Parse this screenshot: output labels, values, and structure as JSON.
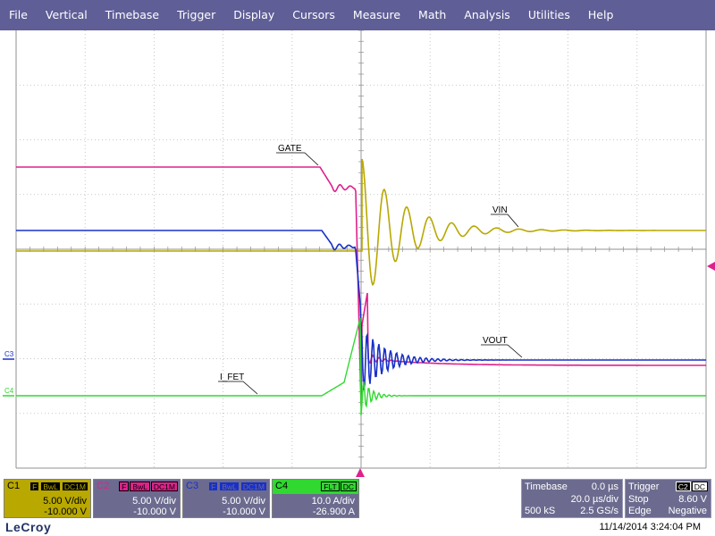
{
  "menu": [
    "File",
    "Vertical",
    "Timebase",
    "Trigger",
    "Display",
    "Cursors",
    "Measure",
    "Math",
    "Analysis",
    "Utilities",
    "Help"
  ],
  "labels": {
    "gate": "GATE",
    "vin": "VIN",
    "vout": "VOUT",
    "ifet": "I_FET",
    "c3_marker": "C3",
    "c4_marker": "C4"
  },
  "colors": {
    "menu_bg": "#5f5e97",
    "c1": "#b8a800",
    "c2": "#e0208c",
    "c3": "#1830c8",
    "c4": "#30d830",
    "trigger_marker": "#e0208c",
    "grid": "#b8b8b8"
  },
  "channels": [
    {
      "id": "c1",
      "name": "C1",
      "flags": [
        "F",
        "BwL",
        "DC1M"
      ],
      "vdiv": "5.00 V/div",
      "offset": "-10.000 V"
    },
    {
      "id": "c2",
      "name": "C2",
      "flags": [
        "F",
        "BwL",
        "DC1M"
      ],
      "vdiv": "5.00 V/div",
      "offset": "-10.000 V"
    },
    {
      "id": "c3",
      "name": "C3",
      "flags": [
        "F",
        "BwL",
        "DC1M"
      ],
      "vdiv": "5.00 V/div",
      "offset": "-10.000 V"
    },
    {
      "id": "c4",
      "name": "C4",
      "flags": [
        "FLT",
        "DC"
      ],
      "vdiv": "10.0 A/div",
      "offset": "-26.900 A"
    }
  ],
  "timebase": {
    "label": "Timebase",
    "delay": "0.0 µs",
    "tdiv": "20.0 µs/div",
    "samples": "500 kS",
    "rate": "2.5 GS/s"
  },
  "trigger": {
    "label": "Trigger",
    "source": "C2",
    "mode_label": "DC",
    "mode": "Stop",
    "level": "8.60 V",
    "type": "Edge",
    "slope": "Negative"
  },
  "brand": "LeCroy",
  "datetime": "11/14/2014 3:24:04 PM"
}
